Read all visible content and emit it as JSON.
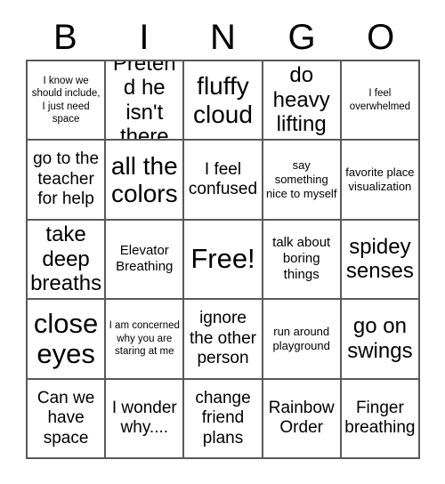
{
  "card": {
    "title_letters": [
      "B",
      "I",
      "N",
      "G",
      "O"
    ],
    "columns": 5,
    "rows": 5,
    "border_color": "#595959",
    "background_color": "#ffffff",
    "text_color": "#000000",
    "free_space": "Free!",
    "cells": [
      {
        "text": "I know we should include, I just need space",
        "size": "fs-xs"
      },
      {
        "text": "Pretend he isn't there",
        "size": "fs-xl"
      },
      {
        "text": "fluffy cloud",
        "size": "fs-2xl"
      },
      {
        "text": "do heavy lifting",
        "size": "fs-xl"
      },
      {
        "text": "I feel overwhelmed",
        "size": "fs-xs"
      },
      {
        "text": "go to the teacher for help",
        "size": "fs-lg"
      },
      {
        "text": "all the colors",
        "size": "fs-2xl"
      },
      {
        "text": "I feel confused",
        "size": "fs-lg"
      },
      {
        "text": "say something nice to myself",
        "size": "fs-sm"
      },
      {
        "text": "favorite place visualization",
        "size": "fs-sm"
      },
      {
        "text": "take deep breaths",
        "size": "fs-xl"
      },
      {
        "text": "Elevator Breathing",
        "size": "fs-md"
      },
      {
        "text": "Free!",
        "size": "fs-3xl"
      },
      {
        "text": "talk about boring things",
        "size": "fs-md"
      },
      {
        "text": "spidey senses",
        "size": "fs-xl"
      },
      {
        "text": "close eyes",
        "size": "fs-3xl"
      },
      {
        "text": "I am concerned why you are staring at me",
        "size": "fs-xs"
      },
      {
        "text": "ignore the other person",
        "size": "fs-lg"
      },
      {
        "text": "run around playground",
        "size": "fs-sm"
      },
      {
        "text": "go on swings",
        "size": "fs-xl"
      },
      {
        "text": "Can we have space",
        "size": "fs-lg"
      },
      {
        "text": "I wonder why....",
        "size": "fs-lg"
      },
      {
        "text": "change friend plans",
        "size": "fs-lg"
      },
      {
        "text": "Rainbow Order",
        "size": "fs-lg"
      },
      {
        "text": "Finger breathing",
        "size": "fs-lg"
      }
    ]
  }
}
